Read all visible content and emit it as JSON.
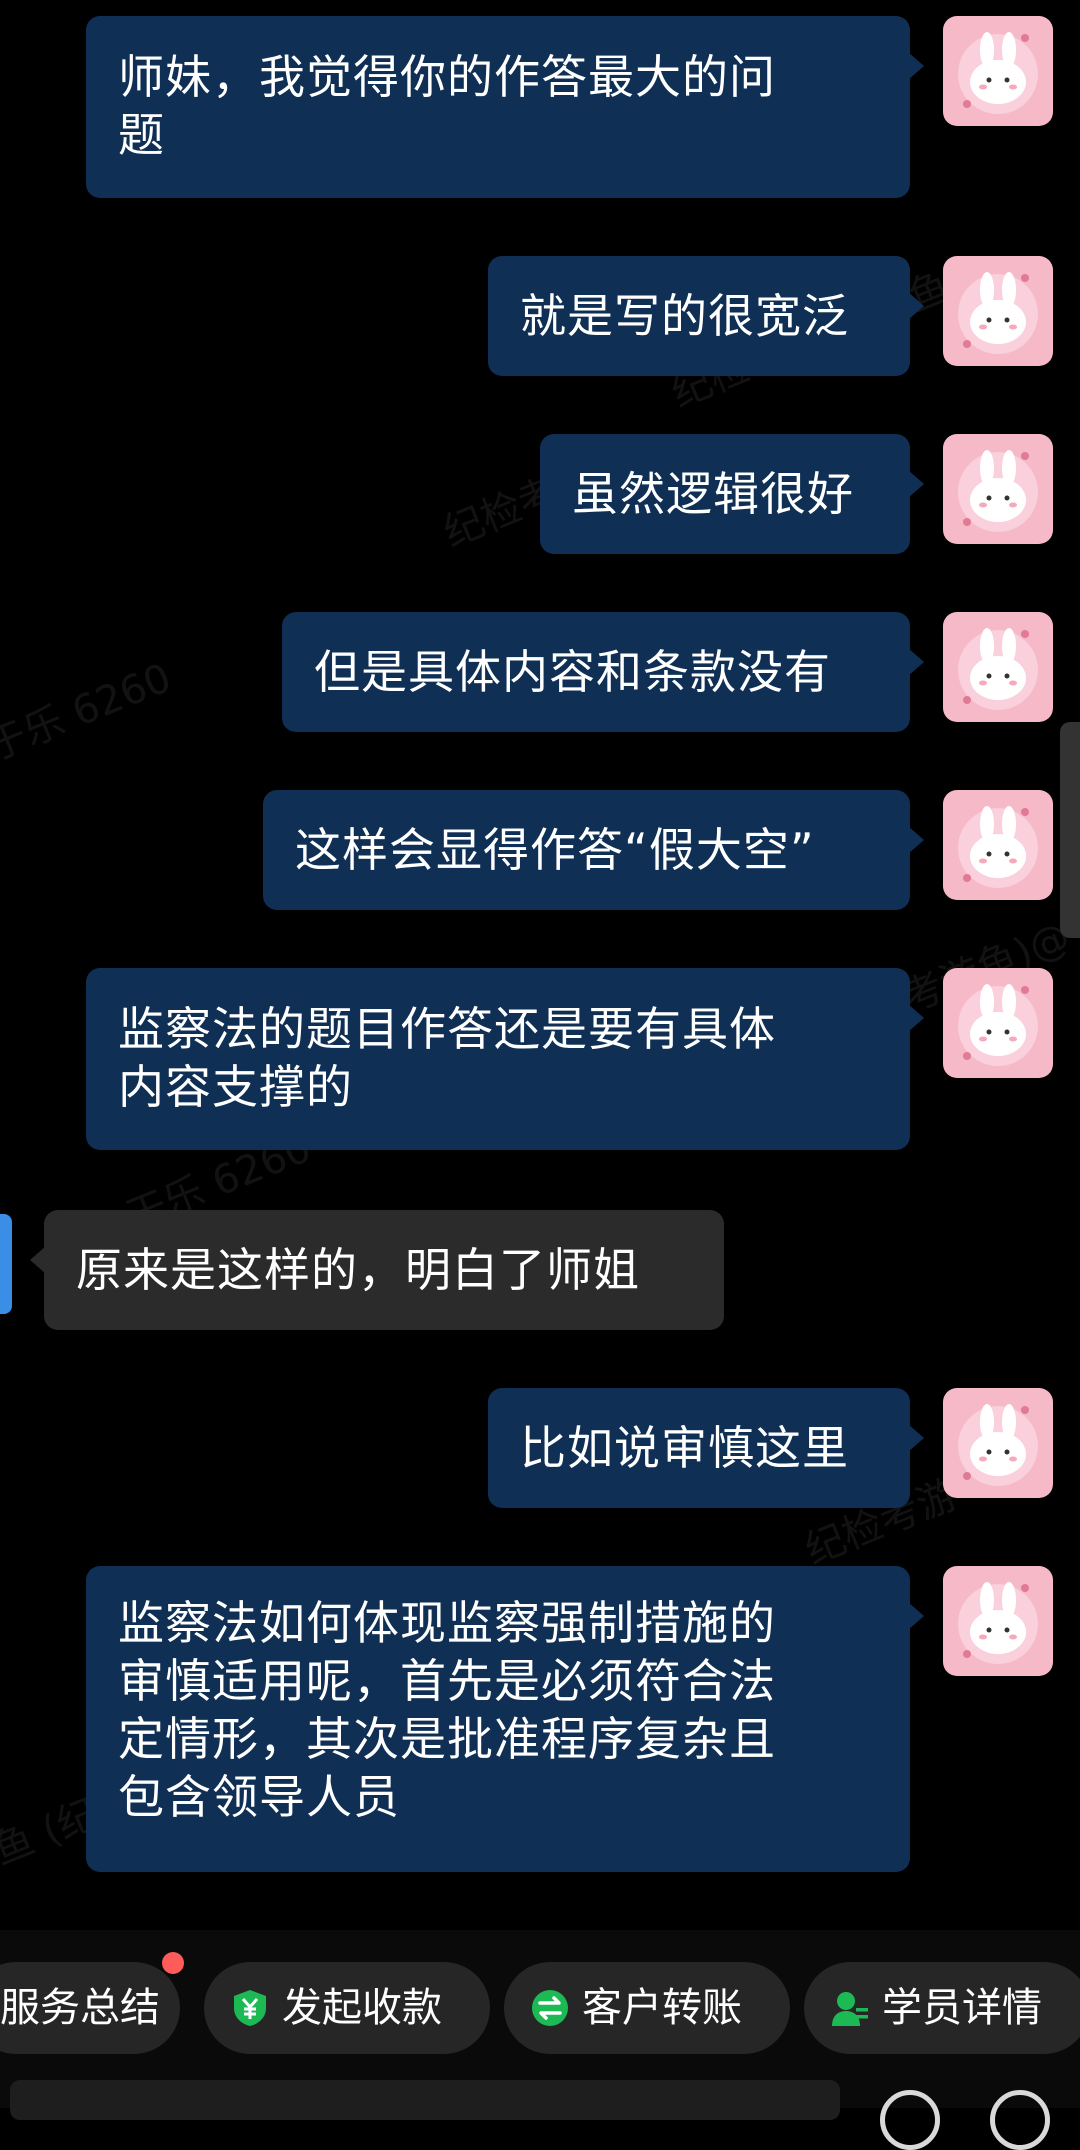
{
  "messages": [
    {
      "direction": "out",
      "lines": [
        "师妹，我觉得你的作答最大的问",
        "题"
      ]
    },
    {
      "direction": "out",
      "lines": [
        "就是写的很宽泛"
      ]
    },
    {
      "direction": "out",
      "lines": [
        "虽然逻辑很好"
      ]
    },
    {
      "direction": "out",
      "lines": [
        "但是具体内容和条款没有"
      ]
    },
    {
      "direction": "out",
      "lines": [
        "这样会显得作答“假大空”"
      ]
    },
    {
      "direction": "out",
      "lines": [
        "监察法的题目作答还是要有具体",
        "内容支撑的"
      ]
    },
    {
      "direction": "in",
      "lines": [
        "原来是这样的，明白了师姐"
      ]
    },
    {
      "direction": "out",
      "lines": [
        "比如说审慎这里"
      ]
    },
    {
      "direction": "out",
      "lines": [
        "监察法如何体现监察强制措施的",
        "审慎适用呢，首先是必须符合法",
        "定情形，其次是批准程序复杂且",
        "包含领导人员"
      ]
    }
  ],
  "avatar_icon": "bunny-avatar-icon",
  "watermarks": [
    "纪检考游鱼)@鱼教",
    "纪检考",
    "于乐 6260",
    "纪检考游鱼)@",
    "干乐 6260",
    "纪检考游",
    "鱼 (纪"
  ],
  "toolbar": {
    "chips": [
      {
        "label": "服务总结",
        "icon": "",
        "badge": true
      },
      {
        "label": "发起收款",
        "icon": "yuan-shield-icon",
        "badge": false
      },
      {
        "label": "客户转账",
        "icon": "transfer-icon",
        "badge": false
      },
      {
        "label": "学员详情",
        "icon": "student-icon",
        "badge": false
      }
    ]
  },
  "colors": {
    "background": "#000000",
    "outgoing_bubble": "#0f2f55",
    "incoming_bubble": "#2b2b2b",
    "accent_green": "#1db954",
    "badge_red": "#ff5b5b"
  }
}
